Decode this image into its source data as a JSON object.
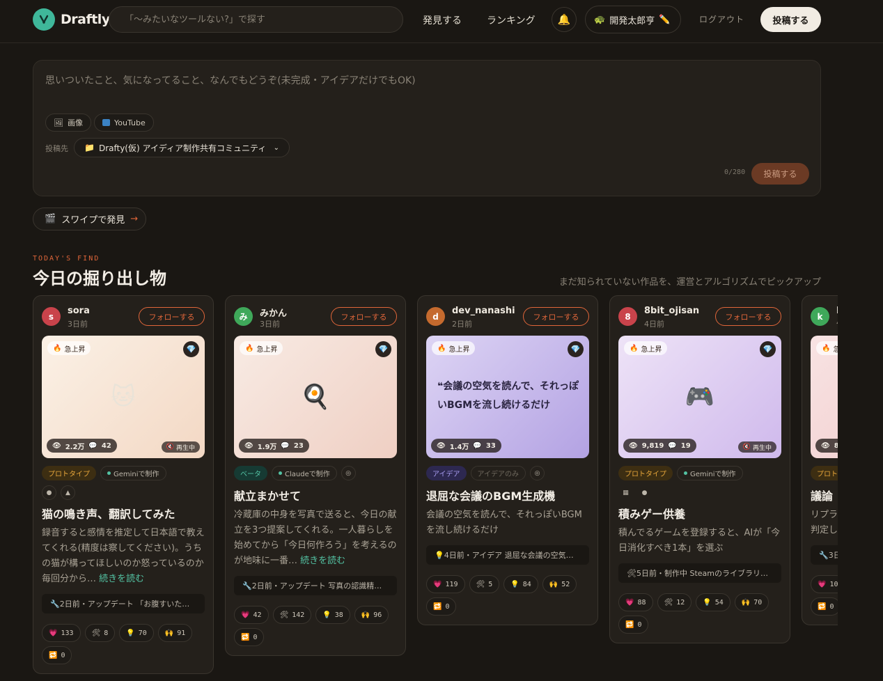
{
  "header": {
    "logo_text": "Draftly",
    "search_placeholder": "「〜みたいなツールない?」で探す",
    "nav": [
      "発見する",
      "ランキング"
    ],
    "user_name": "開発太郎亨",
    "logout": "ログアウト",
    "post_label": "投稿する"
  },
  "composer": {
    "placeholder": "思いついたこと、気になってること、なんでもどうぞ(未完成・アイデアだけでもOK)",
    "image_label": "画像",
    "youtube_label": "YouTube",
    "target_label": "投稿先",
    "target_value": "Drafty(仮) アイディア制作共有コミュニティ",
    "counter": "0/280",
    "post_label": "投稿する"
  },
  "swipe": {
    "label": "スワイプで発見",
    "arrow": "→"
  },
  "section": {
    "eyebrow": "TODAY'S FIND",
    "title": "今日の掘り出し物",
    "subtitle": "まだ知られていない作品を、運営とアルゴリズムでピックアップ"
  },
  "common": {
    "follow": "フォローする",
    "hot": "急上昇",
    "playing": "再生中",
    "more": "続きを読む"
  },
  "cards": [
    {
      "avatar": "s",
      "avatar_color": "#c9434b",
      "user": "sora",
      "time": "3日前",
      "views": "2.2万",
      "comments": "42",
      "tags": [
        "プロトタイプ",
        "Geminiで制作"
      ],
      "title": "猫の鳴き声、翻訳してみた",
      "desc": "録音すると感情を推定して日本語で教えてくれる(精度は察してください)。うちの猫が構ってほしいのか怒っているのか毎回分から…",
      "update": "2日前・アップデート 「お腹すいた…",
      "reacts": [
        "133",
        "8",
        "70",
        "91",
        "0"
      ]
    },
    {
      "avatar": "み",
      "avatar_color": "#3fa85a",
      "user": "みかん",
      "time": "3日前",
      "views": "1.9万",
      "comments": "23",
      "tags": [
        "ベータ",
        "Claudeで制作"
      ],
      "title": "献立まかせて",
      "desc": "冷蔵庫の中身を写真で送ると、今日の献立を3つ提案してくれる。一人暮らしを始めてから「今日何作ろう」を考えるのが地味に一番…",
      "update": "2日前・アップデート 写真の認識精…",
      "reacts": [
        "42",
        "142",
        "38",
        "96",
        "0"
      ]
    },
    {
      "avatar": "d",
      "avatar_color": "#c56a2e",
      "user": "dev_nanashi",
      "time": "2日前",
      "views": "1.4万",
      "comments": "33",
      "quote": "会議の空気を読んで、それっぽいBGMを流し続けるだけ",
      "tags": [
        "アイデア",
        "アイデアのみ"
      ],
      "title": "退屈な会議のBGM生成機",
      "desc": "会議の空気を読んで、それっぽいBGMを流し続けるだけ",
      "update": "4日前・アイデア 退屈な会議の空気…",
      "reacts": [
        "119",
        "5",
        "84",
        "52",
        "0"
      ]
    },
    {
      "avatar": "8",
      "avatar_color": "#c9434b",
      "user": "8bit_ojisan",
      "time": "4日前",
      "views": "9,819",
      "comments": "19",
      "tags": [
        "プロトタイプ",
        "Geminiで制作"
      ],
      "title": "積みゲー供養",
      "desc": "積んでるゲームを登録すると、AIが「今日消化すべき1本」を選ぶ",
      "update": "5日前・制作中 Steamのライブラリ…",
      "reacts": [
        "88",
        "12",
        "54",
        "70",
        "0"
      ]
    },
    {
      "avatar": "k",
      "avatar_color": "#3fa85a",
      "user": "k",
      "time": "4",
      "views": "8",
      "comments": "",
      "tags": [
        "プロト"
      ],
      "title": "議論",
      "desc": "リプラ判定し",
      "update": "3日",
      "reacts": [
        "10",
        "0"
      ]
    }
  ]
}
